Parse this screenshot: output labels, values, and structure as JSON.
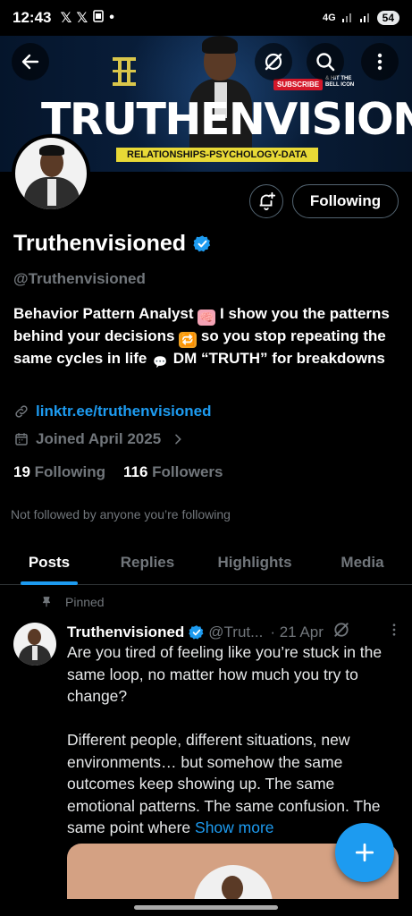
{
  "status_bar": {
    "time": "12:43",
    "notif_icons": [
      "x-logo-icon",
      "x-logo-icon",
      "screenshot-icon",
      "dot-icon"
    ],
    "network": "4G",
    "battery": "54"
  },
  "banner": {
    "brand_text": "TRUTHENVISIONED",
    "tagline": "RELATIONSHIPS-PSYCHOLOGY-DATA",
    "subscribe_label": "SUBSCRIBE",
    "bell_text": "& HIT THE BELL ICON"
  },
  "toolbar": {
    "back_icon": "arrow-left-icon",
    "grok_icon": "grok-icon",
    "search_icon": "search-icon",
    "more_icon": "more-vertical-icon"
  },
  "profile": {
    "notify_icon": "bell-plus-icon",
    "following_label": "Following",
    "display_name": "Truthenvisioned",
    "handle": "@Truthenvisioned",
    "bio_part1": "Behavior Pattern Analyst",
    "bio_part2": "I show you the patterns behind your decisions",
    "bio_part3": "so you stop repeating the same cycles in life",
    "bio_part4": "DM “TRUTH” for breakdowns",
    "link": "linktr.ee/truthenvisioned",
    "joined": "Joined April 2025",
    "following_count": "19",
    "following_text": "Following",
    "followers_count": "116",
    "followers_text": "Followers",
    "not_followed_note": "Not followed by anyone you’re following"
  },
  "tabs": [
    {
      "label": "Posts",
      "active": true
    },
    {
      "label": "Replies",
      "active": false
    },
    {
      "label": "Highlights",
      "active": false
    },
    {
      "label": "Media",
      "active": false
    }
  ],
  "pinned_post": {
    "pinned_label": "Pinned",
    "author_name": "Truthenvisioned",
    "author_handle": "@Trut...",
    "date": "· 21 Apr",
    "paragraph1": "Are you tired of feeling like you’re stuck in the same loop, no matter how much you try to change?",
    "paragraph2": "Different people, different situations, new environments… but somehow the same outcomes keep showing up. The same emotional patterns. The same confusion. The same point where",
    "show_more": "Show more"
  },
  "fab": {
    "icon": "plus-icon"
  },
  "colors": {
    "accent": "#1d9bf0",
    "background": "#000000",
    "muted": "#71767b",
    "tagline_yellow": "#e8d936"
  }
}
